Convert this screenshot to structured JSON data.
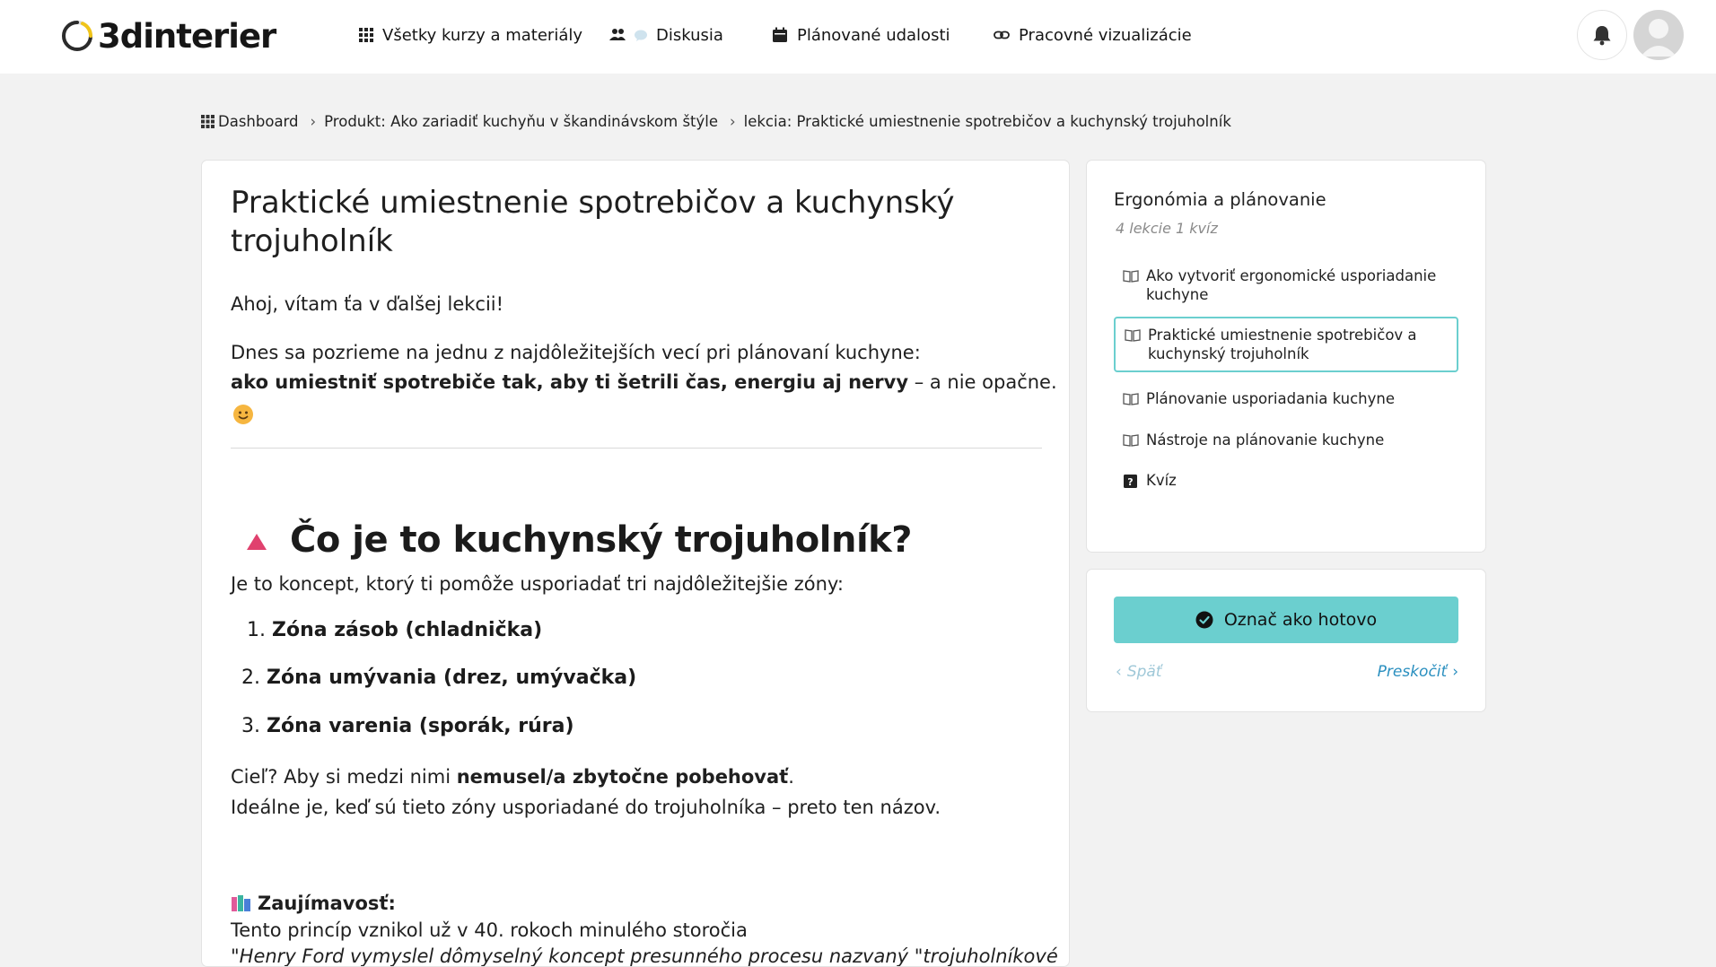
{
  "brand": {
    "name": "3dinterier"
  },
  "nav": {
    "items": [
      {
        "label": "Všetky kurzy a materiály",
        "icon": "grid-icon"
      },
      {
        "label": "Diskusia",
        "icon": "users-chat-icon"
      },
      {
        "label": "Plánované udalosti",
        "icon": "calendar-icon"
      },
      {
        "label": "Pracovné vizualizácie",
        "icon": "link-icon"
      }
    ]
  },
  "breadcrumb": {
    "items": [
      "Dashboard",
      "Produkt: Ako zariadiť kuchyňu v škandinávskom štýle",
      "lekcia: Praktické umiestnenie spotrebičov a kuchynský trojuholník"
    ]
  },
  "lesson": {
    "title": "Praktické umiestnenie spotrebičov a kuchynský trojuholník",
    "greeting": "Ahoj, vítam ťa v ďalšej lekcii!",
    "intro_line": "Dnes sa pozrieme na jednu z najdôležitejších vecí pri plánovaní kuchyne:",
    "intro_bold": "ako umiestniť spotrebiče tak, aby ti šetrili čas, energiu aj nervy",
    "intro_end": " – a nie opačne.",
    "section_heading": "Čo je to kuchynský trojuholník?",
    "section_text": "Je to koncept, ktorý ti pomôže usporiadať tri najdôležitejšie zóny:",
    "zones": [
      {
        "num": "1.",
        "text": "Zóna zásob (chladnička)"
      },
      {
        "num": "2.",
        "text": "Zóna umývania (drez, umývačka)"
      },
      {
        "num": "3.",
        "text": "Zóna varenia (sporák, rúra)"
      }
    ],
    "goal_start": "Cieľ? Aby si medzi nimi ",
    "goal_bold": "nemusel/a zbytočne pobehovať",
    "goal_end": ".",
    "ideal_text": "Ideálne je, keď sú tieto zóny usporiadané do trojuholníka – preto ten názov.",
    "fact_title": "Zaujímavosť:",
    "fact_text": "Tento princíp vznikol už v 40. rokoch minulého storočia",
    "fact_cut": "\"Henry Ford vymyslel dômyselný koncept presunného procesu nazvaný \"trojuholníkové"
  },
  "sidebar": {
    "module_title": "Ergonómia a plánovanie",
    "module_meta": "4  lekcie 1  kvíz",
    "items": [
      {
        "label": "Ako vytvoriť ergonomické usporiadanie kuchyne",
        "icon": "book-icon"
      },
      {
        "label": "Praktické umiestnenie spotrebičov a kuchynský trojuholník",
        "icon": "book-icon",
        "active": true
      },
      {
        "label": "Plánovanie usporiadania kuchyne",
        "icon": "book-icon"
      },
      {
        "label": "Nástroje na plánovanie kuchyne",
        "icon": "book-icon"
      },
      {
        "label": "Kvíz",
        "icon": "quiz-icon"
      }
    ]
  },
  "completion": {
    "button_label": "Označ ako hotovo",
    "back_label": "Späť",
    "skip_label": "Preskočiť"
  },
  "colors": {
    "accent": "#6bcfcf",
    "link": "#2a8fbf",
    "muted": "#9fc8d8",
    "triangle": "#e0416e"
  }
}
